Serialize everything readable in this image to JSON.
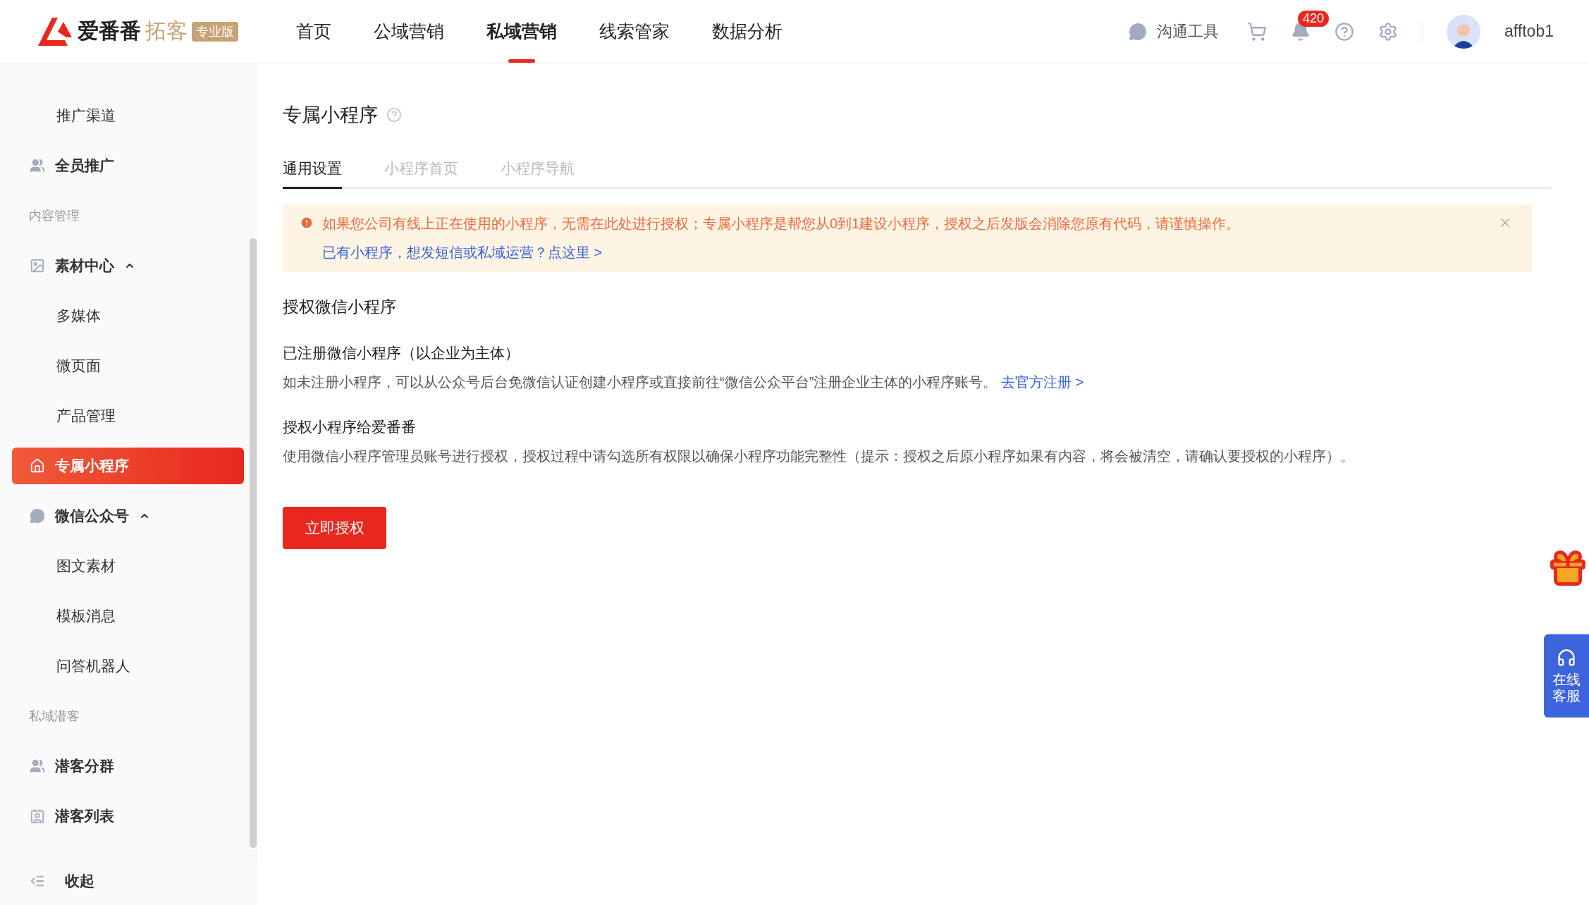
{
  "header": {
    "logo": {
      "name": "爱番番",
      "product": "拓客",
      "badge": "专业版"
    },
    "nav": [
      {
        "label": "首页",
        "selected": false
      },
      {
        "label": "公域营销",
        "selected": false
      },
      {
        "label": "私域营销",
        "selected": true
      },
      {
        "label": "线索管家",
        "selected": false
      },
      {
        "label": "数据分析",
        "selected": false
      }
    ],
    "chat_label": "沟通工具",
    "notification_count": "420",
    "username": "afftob1"
  },
  "sidebar": {
    "items": [
      {
        "kind": "sub",
        "label": "推广渠道",
        "selected": false
      },
      {
        "kind": "item",
        "label": "全员推广",
        "selected": false
      },
      {
        "kind": "section",
        "label": "内容管理"
      },
      {
        "kind": "group",
        "label": "素材中心",
        "expanded": true,
        "selected": false
      },
      {
        "kind": "sub",
        "label": "多媒体",
        "selected": false
      },
      {
        "kind": "sub",
        "label": "微页面",
        "selected": false
      },
      {
        "kind": "sub",
        "label": "产品管理",
        "selected": false
      },
      {
        "kind": "item",
        "label": "专属小程序",
        "selected": true
      },
      {
        "kind": "group",
        "label": "微信公众号",
        "expanded": true,
        "selected": false
      },
      {
        "kind": "sub",
        "label": "图文素材",
        "selected": false
      },
      {
        "kind": "sub",
        "label": "模板消息",
        "selected": false
      },
      {
        "kind": "sub",
        "label": "问答机器人",
        "selected": false
      },
      {
        "kind": "section",
        "label": "私域潜客"
      },
      {
        "kind": "item",
        "label": "潜客分群",
        "selected": false
      },
      {
        "kind": "item",
        "label": "潜客列表",
        "selected": false
      }
    ],
    "collapse_label": "收起"
  },
  "page": {
    "title": "专属小程序",
    "tabs": [
      {
        "label": "通用设置",
        "selected": true
      },
      {
        "label": "小程序首页",
        "selected": false
      },
      {
        "label": "小程序导航",
        "selected": false
      }
    ],
    "alert": {
      "message": "如果您公司有线上正在使用的小程序，无需在此处进行授权；专属小程序是帮您从0到1建设小程序，授权之后发版会消除您原有代码，请谨慎操作。",
      "link": "已有小程序，想发短信或私域运营？点这里 >"
    },
    "section_title": "授权微信小程序",
    "steps": [
      {
        "title": "已注册微信小程序（以企业为主体）",
        "text": "如未注册小程序，可以从公众号后台免微信认证创建小程序或直接前往“微信公众平台”注册企业主体的小程序账号。",
        "link": "去官方注册 >"
      },
      {
        "title": "授权小程序给爱番番",
        "text": "使用微信小程序管理员账号进行授权，授权过程中请勾选所有权限以确保小程序功能完整性（提示：授权之后原小程序如果有内容，将会被清空，请确认要授权的小程序）。"
      }
    ],
    "button": "立即授权"
  },
  "support": {
    "label": "在线客服"
  }
}
